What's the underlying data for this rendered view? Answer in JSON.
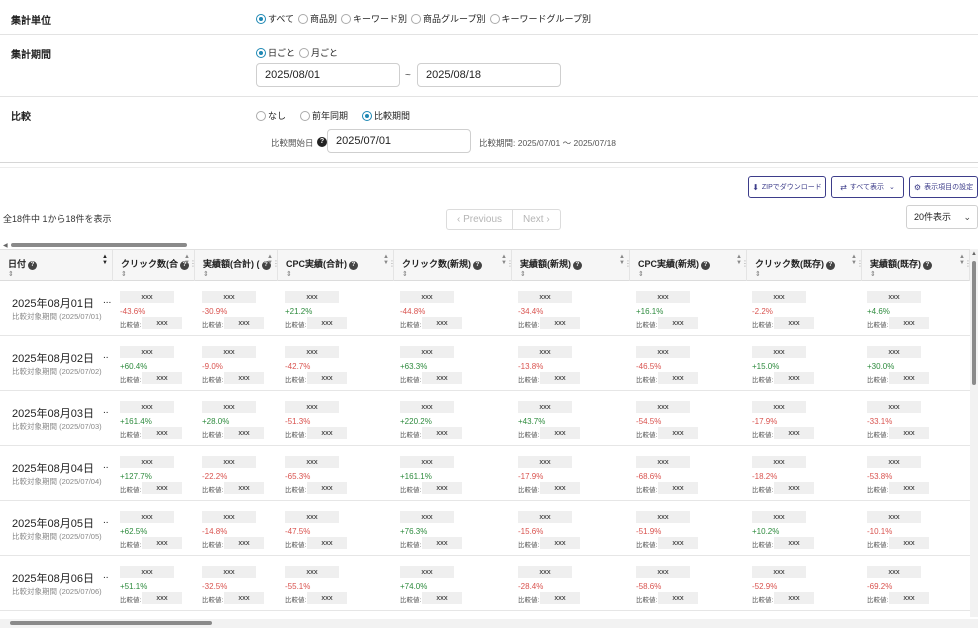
{
  "filters": {
    "unit": {
      "label": "集計単位",
      "options": [
        {
          "label": "すべて",
          "selected": true
        },
        {
          "label": "商品別",
          "selected": false
        },
        {
          "label": "キーワード別",
          "selected": false
        },
        {
          "label": "商品グループ別",
          "selected": false
        },
        {
          "label": "キーワードグループ別",
          "selected": false
        }
      ]
    },
    "period": {
      "label": "集計期間",
      "options": [
        {
          "label": "日ごと",
          "selected": true
        },
        {
          "label": "月ごと",
          "selected": false
        }
      ],
      "start": "2025/08/01",
      "tilde": "~",
      "end": "2025/08/18"
    },
    "compare": {
      "label": "比較",
      "options": [
        {
          "label": "なし",
          "selected": false
        },
        {
          "label": "前年同期",
          "selected": false
        },
        {
          "label": "比較期間",
          "selected": true
        }
      ],
      "start_label": "比較開始日",
      "start_value": "2025/07/01",
      "period_text": "比較期間: 2025/07/01 〜 2025/07/18"
    }
  },
  "toolbar": {
    "zip_label": "ZIPでダウンロード",
    "show_all_label": "すべて表示",
    "settings_label": "表示項目の設定",
    "count_text": "全18件中 1から18件を表示",
    "prev_label": "‹ Previous",
    "next_label": "Next ›",
    "per_page": "20件表示"
  },
  "table": {
    "columns": [
      {
        "label": "日付",
        "filter": "⇕"
      },
      {
        "label": "クリック数(合",
        "filter": "⇕"
      },
      {
        "label": "実績額(合計) (",
        "filter": "⇕"
      },
      {
        "label": "CPC実績(合計)",
        "filter": "⇕"
      },
      {
        "label": "クリック数(新規)",
        "filter": "⇕"
      },
      {
        "label": "実績額(新規)",
        "filter": "⇕"
      },
      {
        "label": "CPC実績(新規)",
        "filter": "⇕"
      },
      {
        "label": "クリック数(既存)",
        "filter": "⇕"
      },
      {
        "label": "実績額(既存)",
        "filter": "⇕"
      }
    ],
    "more": "..",
    "cell_value": "xxx",
    "compare_prefix": "比較値:",
    "rows": [
      {
        "date": "2025年08月01日",
        "more": "...",
        "compare_date": "比較対象期間 (2025/07/01)",
        "changes": [
          "-43.6%",
          "-30.9%",
          "+21.2%",
          "-44.8%",
          "-34.4%",
          "+16.1%",
          "-2.2%",
          "+4.6%"
        ]
      },
      {
        "date": "2025年08月02日",
        "more": "..",
        "compare_date": "比較対象期間 (2025/07/02)",
        "changes": [
          "+60.4%",
          "-9.0%",
          "-42.7%",
          "+63.3%",
          "-13.8%",
          "-46.5%",
          "+15.0%",
          "+30.0%"
        ]
      },
      {
        "date": "2025年08月03日",
        "more": "..",
        "compare_date": "比較対象期間 (2025/07/03)",
        "changes": [
          "+161.4%",
          "+28.0%",
          "-51.3%",
          "+220.2%",
          "+43.7%",
          "-54.5%",
          "-17.9%",
          "-33.1%"
        ]
      },
      {
        "date": "2025年08月04日",
        "more": "..",
        "compare_date": "比較対象期間 (2025/07/04)",
        "changes": [
          "+127.7%",
          "-22.2%",
          "-65.3%",
          "+161.1%",
          "-17.9%",
          "-68.6%",
          "-18.2%",
          "-53.8%"
        ]
      },
      {
        "date": "2025年08月05日",
        "more": "..",
        "compare_date": "比較対象期間 (2025/07/05)",
        "changes": [
          "+62.5%",
          "-14.8%",
          "-47.5%",
          "+76.3%",
          "-15.6%",
          "-51.9%",
          "+10.2%",
          "-10.1%"
        ]
      },
      {
        "date": "2025年08月06日",
        "more": "..",
        "compare_date": "比較対象期間 (2025/07/06)",
        "changes": [
          "+51.1%",
          "-32.5%",
          "-55.1%",
          "+74.0%",
          "-28.4%",
          "-58.6%",
          "-52.9%",
          "-69.2%"
        ]
      }
    ]
  },
  "colors": {
    "accent": "#1e88b4",
    "button": "#3d3d8a",
    "positive": "#2e8b3e",
    "negative": "#d9534f"
  }
}
